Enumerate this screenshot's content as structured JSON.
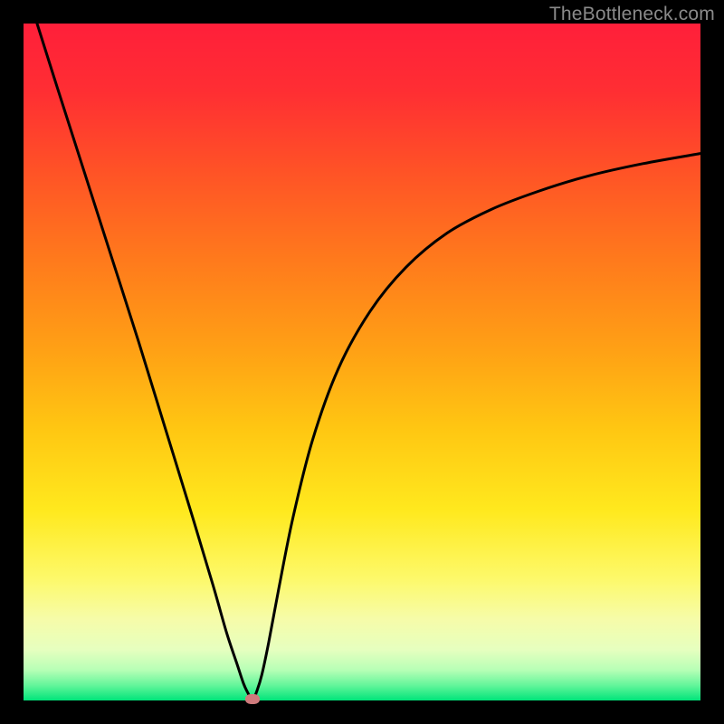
{
  "watermark": "TheBottleneck.com",
  "colors": {
    "frame": "#000000",
    "gradient_stops": [
      {
        "offset": 0.0,
        "color": "#ff1f3a"
      },
      {
        "offset": 0.1,
        "color": "#ff2e33"
      },
      {
        "offset": 0.22,
        "color": "#ff5326"
      },
      {
        "offset": 0.35,
        "color": "#ff7a1c"
      },
      {
        "offset": 0.48,
        "color": "#ffa015"
      },
      {
        "offset": 0.6,
        "color": "#ffc712"
      },
      {
        "offset": 0.72,
        "color": "#ffe91e"
      },
      {
        "offset": 0.82,
        "color": "#fdf96a"
      },
      {
        "offset": 0.88,
        "color": "#f6fca9"
      },
      {
        "offset": 0.925,
        "color": "#e6ffbf"
      },
      {
        "offset": 0.955,
        "color": "#b7ffb6"
      },
      {
        "offset": 0.978,
        "color": "#62f59a"
      },
      {
        "offset": 1.0,
        "color": "#00e47a"
      }
    ],
    "curve": "#000000",
    "marker": "#cf7a7c"
  },
  "chart_data": {
    "type": "line",
    "title": "",
    "xlabel": "",
    "ylabel": "",
    "xlim": [
      0,
      1
    ],
    "ylim": [
      0,
      1
    ],
    "grid": false,
    "legend": false,
    "series": [
      {
        "name": "bottleneck-curve",
        "x": [
          0.02,
          0.05,
          0.09,
          0.13,
          0.17,
          0.21,
          0.25,
          0.28,
          0.3,
          0.315,
          0.325,
          0.332,
          0.338,
          0.344,
          0.352,
          0.362,
          0.377,
          0.398,
          0.427,
          0.465,
          0.512,
          0.565,
          0.625,
          0.69,
          0.76,
          0.835,
          0.915,
          1.0
        ],
        "y": [
          1.0,
          0.905,
          0.78,
          0.655,
          0.53,
          0.4,
          0.27,
          0.17,
          0.1,
          0.055,
          0.025,
          0.01,
          0.0,
          0.012,
          0.038,
          0.085,
          0.165,
          0.27,
          0.385,
          0.49,
          0.575,
          0.64,
          0.69,
          0.725,
          0.752,
          0.775,
          0.793,
          0.808
        ]
      }
    ],
    "markers": [
      {
        "name": "optimal-point",
        "x": 0.338,
        "y": 0.0
      }
    ]
  }
}
